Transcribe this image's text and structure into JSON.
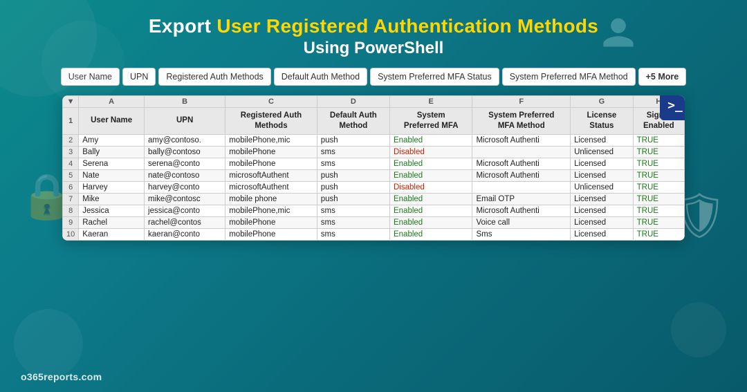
{
  "title": {
    "line1_prefix": "Export ",
    "line1_highlight": "User Registered Authentication Methods",
    "line2": "Using PowerShell"
  },
  "tabs": [
    {
      "label": "User Name"
    },
    {
      "label": "UPN"
    },
    {
      "label": "Registered Auth Methods"
    },
    {
      "label": "Default Auth Method"
    },
    {
      "label": "System Preferred MFA Status"
    },
    {
      "label": "System Preferred MFA Method"
    },
    {
      "label": "+5 More"
    }
  ],
  "spreadsheet": {
    "col_letters": [
      "",
      "A",
      "B",
      "C",
      "D",
      "E",
      "F",
      "G",
      "H"
    ],
    "headers": [
      "",
      "User Name",
      "UPN",
      "Registered Auth Methods",
      "Default Auth Method",
      "System Preferred MFA",
      "System Preferred MFA Method",
      "License Status",
      "Signin Enabled"
    ],
    "rows": [
      {
        "num": "2",
        "cells": [
          "Amy",
          "amy@contoso.",
          "mobilePhone,mic",
          "push",
          "Enabled",
          "Microsoft Authenti",
          "Licensed",
          "TRUE"
        ]
      },
      {
        "num": "3",
        "cells": [
          "Bally",
          "bally@contoso",
          "mobilePhone",
          "sms",
          "Disabled",
          "",
          "Unlicensed",
          "TRUE"
        ]
      },
      {
        "num": "4",
        "cells": [
          "Serena",
          "serena@conto",
          "mobilePhone",
          "sms",
          "Enabled",
          "Microsoft Authenti",
          "Licensed",
          "TRUE"
        ]
      },
      {
        "num": "5",
        "cells": [
          "Nate",
          "nate@contoso",
          "microsoftAuthent",
          "push",
          "Enabled",
          "Microsoft Authenti",
          "Licensed",
          "TRUE"
        ]
      },
      {
        "num": "6",
        "cells": [
          "Harvey",
          "harvey@conto",
          "microsoftAuthent",
          "push",
          "Disabled",
          "",
          "Unlicensed",
          "TRUE"
        ]
      },
      {
        "num": "7",
        "cells": [
          "Mike",
          "mike@contosc",
          "mobile phone",
          "push",
          "Enabled",
          "Email OTP",
          "Licensed",
          "TRUE"
        ]
      },
      {
        "num": "8",
        "cells": [
          "Jessica",
          "jessica@conto",
          "mobilePhone,mic",
          "sms",
          "Enabled",
          "Microsoft Authenti",
          "Licensed",
          "TRUE"
        ]
      },
      {
        "num": "9",
        "cells": [
          "Rachel",
          "rachel@contos",
          "mobilePhone",
          "sms",
          "Enabled",
          "Voice call",
          "Licensed",
          "TRUE"
        ]
      },
      {
        "num": "10",
        "cells": [
          "Kaeran",
          "kaeran@conto",
          "mobilePhone",
          "sms",
          "Enabled",
          "Sms",
          "Licensed",
          "TRUE"
        ]
      }
    ]
  },
  "watermark": "o365reports.com",
  "ps_icon": ">_"
}
